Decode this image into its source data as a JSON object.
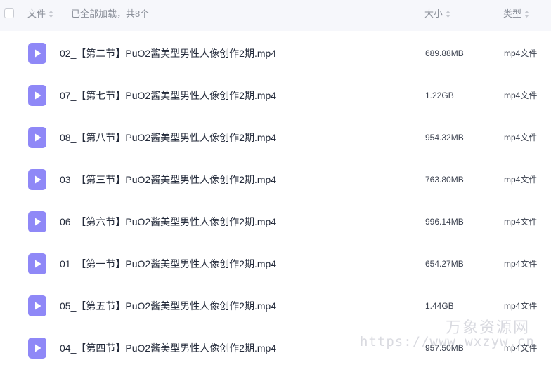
{
  "header": {
    "name_label": "文件",
    "status_text": "已全部加载，共8个",
    "size_label": "大小",
    "type_label": "类型"
  },
  "files": [
    {
      "name": "02_【第二节】PuO2酱美型男性人像创作2期.mp4",
      "size": "689.88MB",
      "type": "mp4文件",
      "icon": "video-file-icon"
    },
    {
      "name": "07_【第七节】PuO2酱美型男性人像创作2期.mp4",
      "size": "1.22GB",
      "type": "mp4文件",
      "icon": "video-file-icon"
    },
    {
      "name": "08_【第八节】PuO2酱美型男性人像创作2期.mp4",
      "size": "954.32MB",
      "type": "mp4文件",
      "icon": "video-file-icon"
    },
    {
      "name": "03_【第三节】PuO2酱美型男性人像创作2期.mp4",
      "size": "763.80MB",
      "type": "mp4文件",
      "icon": "video-file-icon"
    },
    {
      "name": "06_【第六节】PuO2酱美型男性人像创作2期.mp4",
      "size": "996.14MB",
      "type": "mp4文件",
      "icon": "video-file-icon"
    },
    {
      "name": "01_【第一节】PuO2酱美型男性人像创作2期.mp4",
      "size": "654.27MB",
      "type": "mp4文件",
      "icon": "video-file-icon"
    },
    {
      "name": "05_【第五节】PuO2酱美型男性人像创作2期.mp4",
      "size": "1.44GB",
      "type": "mp4文件",
      "icon": "video-file-icon"
    },
    {
      "name": "04_【第四节】PuO2酱美型男性人像创作2期.mp4",
      "size": "957.50MB",
      "type": "mp4文件",
      "icon": "video-file-icon"
    }
  ],
  "watermark": {
    "title": "万象资源网",
    "url": "https://www.wxzyw.cn"
  },
  "colors": {
    "header_bg": "#f6f7fb",
    "icon_purple": "#8f88f7",
    "text_primary": "#232a3a",
    "text_secondary": "#8a8f99"
  }
}
